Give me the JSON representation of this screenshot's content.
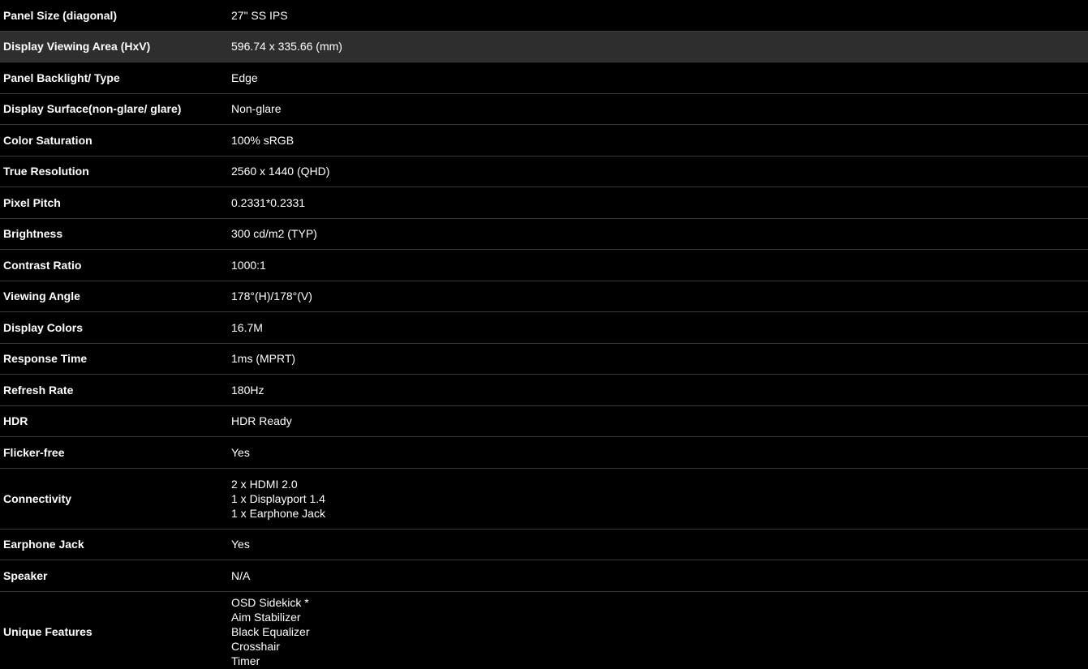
{
  "specs": [
    {
      "label": "Panel Size (diagonal)",
      "values": [
        "27\" SS IPS"
      ]
    },
    {
      "label": "Display Viewing Area (HxV)",
      "values": [
        "596.74 x 335.66 (mm)"
      ]
    },
    {
      "label": "Panel Backlight/ Type",
      "values": [
        "Edge"
      ]
    },
    {
      "label": "Display Surface(non-glare/ glare)",
      "values": [
        "Non-glare"
      ]
    },
    {
      "label": "Color Saturation",
      "values": [
        "100% sRGB"
      ]
    },
    {
      "label": "True Resolution",
      "values": [
        "2560 x 1440 (QHD)"
      ]
    },
    {
      "label": "Pixel Pitch",
      "values": [
        "0.2331*0.2331"
      ]
    },
    {
      "label": "Brightness",
      "values": [
        "300 cd/m2 (TYP)"
      ]
    },
    {
      "label": "Contrast Ratio",
      "values": [
        "1000:1"
      ]
    },
    {
      "label": "Viewing Angle",
      "values": [
        "178°(H)/178°(V)"
      ]
    },
    {
      "label": "Display Colors",
      "values": [
        "16.7M"
      ]
    },
    {
      "label": "Response Time",
      "values": [
        "1ms (MPRT)"
      ]
    },
    {
      "label": "Refresh Rate",
      "values": [
        "180Hz"
      ]
    },
    {
      "label": "HDR",
      "values": [
        "HDR Ready"
      ]
    },
    {
      "label": "Flicker-free",
      "values": [
        "Yes"
      ]
    },
    {
      "label": "Connectivity",
      "values": [
        "2 x HDMI 2.0",
        "1 x Displayport 1.4",
        "1 x Earphone Jack"
      ]
    },
    {
      "label": "Earphone Jack",
      "values": [
        "Yes"
      ]
    },
    {
      "label": "Speaker",
      "values": [
        "N/A"
      ]
    },
    {
      "label": "Unique Features",
      "values": [
        "OSD Sidekick *",
        "Aim Stabilizer",
        "Black Equalizer",
        "Crosshair",
        "Timer"
      ]
    }
  ],
  "colors": {
    "background": "#000000",
    "row_highlight": "#2e2e2e",
    "divider": "#3a3a3a",
    "text": "#ffffff"
  }
}
